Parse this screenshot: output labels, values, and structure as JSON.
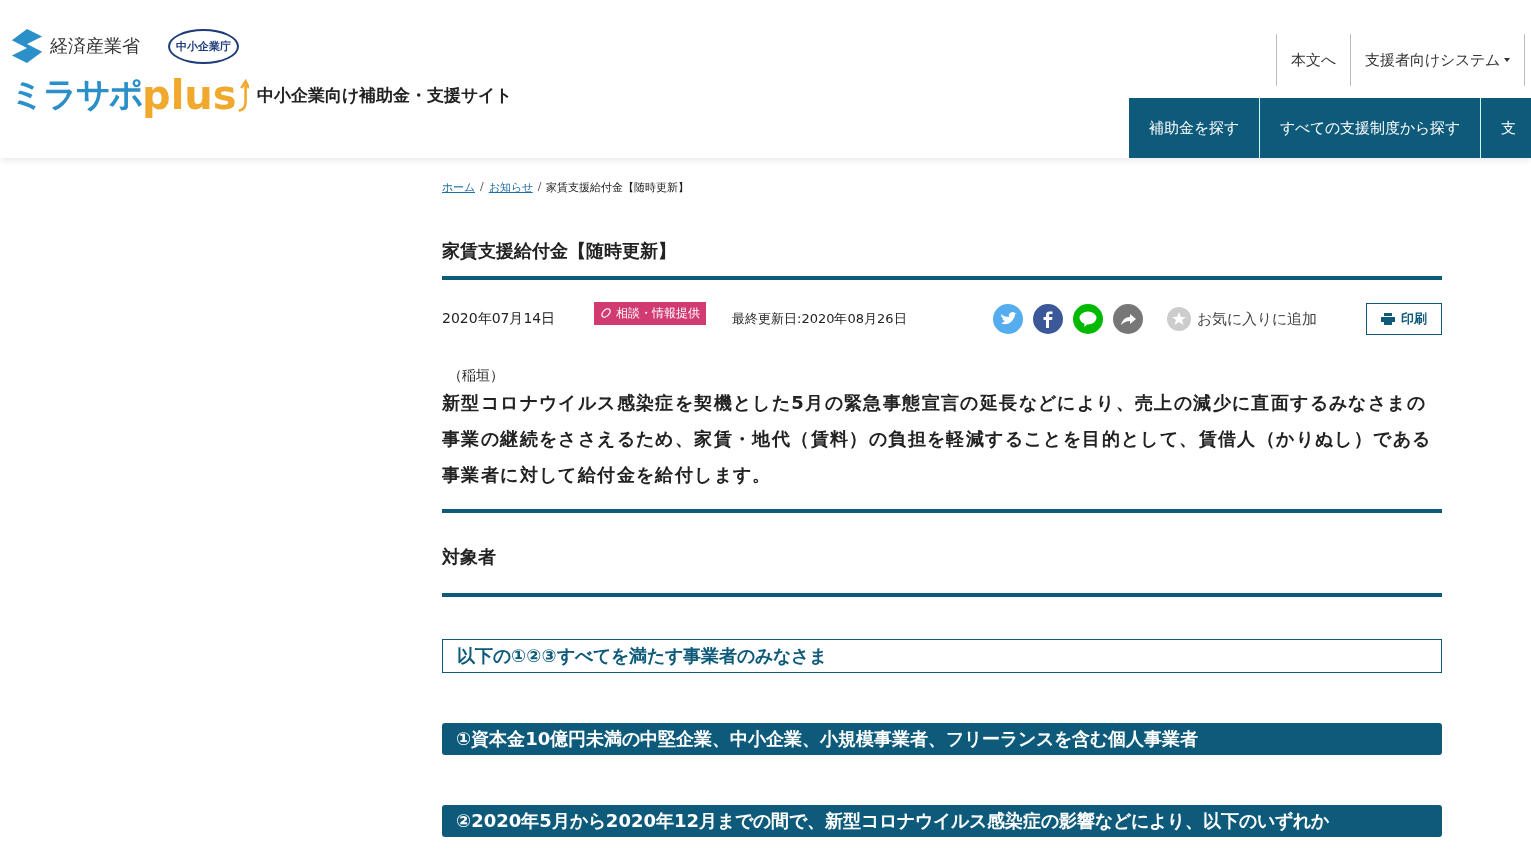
{
  "header": {
    "ministry": "経済産業省",
    "agency": "中小企業庁",
    "brand": "ミラサポ",
    "brand_plus": "plus",
    "tagline": "中小企業向け補助金・支援サイト",
    "utility_links": [
      {
        "label": "本文へ",
        "dropdown": false
      },
      {
        "label": "支援者向けシステム",
        "dropdown": true
      }
    ],
    "nav": [
      {
        "label": "補助金を探す"
      },
      {
        "label": "すべての支援制度から探す"
      },
      {
        "label": "支"
      }
    ]
  },
  "breadcrumb": [
    {
      "label": "ホーム",
      "link": true
    },
    {
      "separator": "/",
      "label": "お知らせ",
      "link": true
    },
    {
      "separator": "/",
      "label": "家賃支援給付金【随時更新】",
      "link": false
    }
  ],
  "article": {
    "title": "家賃支援給付金【随時更新】",
    "date": "2020年07月14日",
    "tag": "相談・情報提供",
    "updated": "最終更新日:2020年08月26日",
    "favorite": "お気に入りに追加",
    "print": "印刷",
    "author": "（稲垣）",
    "lead": "新型コロナウイルス感染症を契機とした5月の緊急事態宣言の延長などにより、売上の減少に直面するみなさまの事業の継続をささえるため、家賃・地代（賃料）の負担を軽減することを目的として、賃借人（かりぬし）である事業者に対して給付金を給付します。",
    "section_title": "対象者",
    "boxes": [
      {
        "kind": "outline",
        "text": "以下の①②③すべてを満たす事業者のみなさま"
      },
      {
        "kind": "filled",
        "text": "①資本金10億円未満の中堅企業、中小企業、小規模事業者、フリーランスを含む個人事業者"
      },
      {
        "kind": "filled",
        "text": "②2020年5月から2020年12月までの間で、新型コロナウイルス感染症の影響などにより、以下のいずれか"
      }
    ]
  }
}
